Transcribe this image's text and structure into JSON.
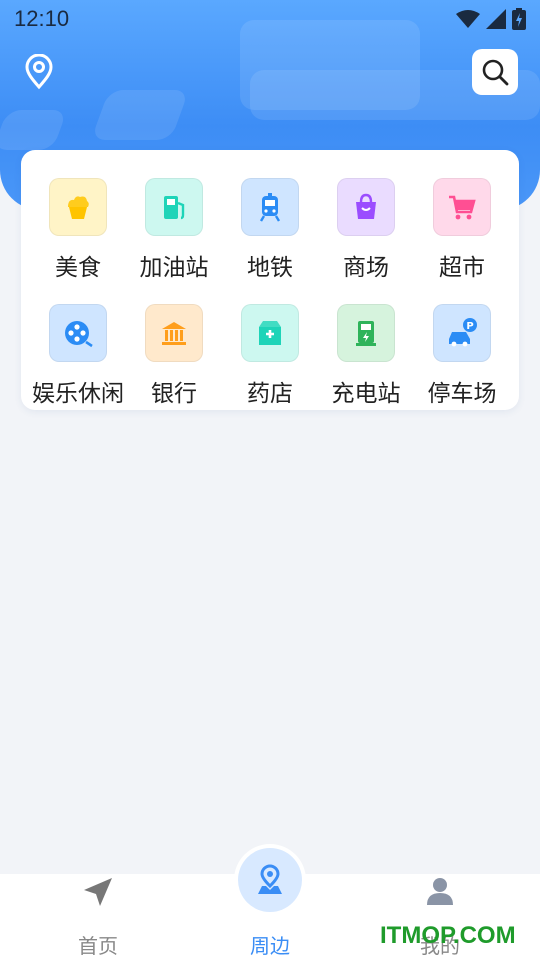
{
  "status_bar": {
    "time": "12:10"
  },
  "categories": [
    {
      "label": "美食",
      "icon": "cupcake-icon",
      "bg": "#fff4c7",
      "fg": "#ffc400"
    },
    {
      "label": "加油站",
      "icon": "gas-station-icon",
      "bg": "#cdf8f0",
      "fg": "#1ed4b8"
    },
    {
      "label": "地铁",
      "icon": "subway-icon",
      "bg": "#cfe5ff",
      "fg": "#2b8cf5"
    },
    {
      "label": "商场",
      "icon": "shopping-bag-icon",
      "bg": "#eadcff",
      "fg": "#9b4dff"
    },
    {
      "label": "超市",
      "icon": "shopping-cart-icon",
      "bg": "#ffd9ea",
      "fg": "#ff4f93"
    },
    {
      "label": "娱乐休闲",
      "icon": "film-reel-icon",
      "bg": "#cfe5ff",
      "fg": "#2b8cf5"
    },
    {
      "label": "银行",
      "icon": "bank-icon",
      "bg": "#ffe9cc",
      "fg": "#ff9e1b"
    },
    {
      "label": "药店",
      "icon": "medicine-box-icon",
      "bg": "#cdf8f0",
      "fg": "#1ed4b8"
    },
    {
      "label": "充电站",
      "icon": "charging-station-icon",
      "bg": "#d6f3dd",
      "fg": "#2fb35a"
    },
    {
      "label": "停车场",
      "icon": "parking-car-icon",
      "bg": "#cfe5ff",
      "fg": "#2b8cf5"
    }
  ],
  "tabs": [
    {
      "label": "首页",
      "icon": "navigation-arrow-icon"
    },
    {
      "label": "周边",
      "icon": "map-pin-icon"
    },
    {
      "label": "我的",
      "icon": "user-icon"
    }
  ],
  "watermark": "ITMOP.COM",
  "colors": {
    "accent": "#3a8df5",
    "header": "#4a97f8",
    "background": "#f2f4f8"
  }
}
